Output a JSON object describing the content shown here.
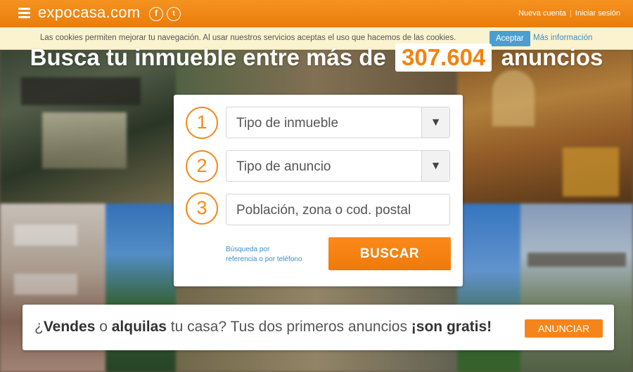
{
  "header": {
    "logo": "expocasa.com",
    "facebook_glyph": "f",
    "twitter_glyph": "t",
    "new_account": "Nueva cuenta",
    "separator": "|",
    "login": "Iniciar sesión"
  },
  "cookie_bar": {
    "message": "Las cookies permiten mejorar tu navegación. Al usar nuestros servicios aceptas el uso que hacemos de las cookies.",
    "accept": "Aceptar",
    "more_info": "Más información"
  },
  "headline": {
    "before": "Busca tu inmueble entre más de",
    "count": "307.604",
    "after": "anuncios"
  },
  "search": {
    "steps": [
      "1",
      "2",
      "3"
    ],
    "property_type": "Tipo de inmueble",
    "listing_type": "Tipo de anuncio",
    "location_placeholder": "Población, zona o cod. postal",
    "ref_link_line1": "Búsqueda por",
    "ref_link_line2": "referencia o por teléfono",
    "search_button": "BUSCAR",
    "dropdown_arrow": "▼"
  },
  "banner": {
    "q_open": "¿",
    "sell": "Vendes",
    "or": " o ",
    "rent": "alquilas",
    "middle": " tu casa? Tus dos primeros anuncios ",
    "free": "¡son gratis!",
    "button": "ANUNCIAR"
  },
  "colors": {
    "brand_orange": "#f08410",
    "link_blue": "#3a8fc8",
    "cookie_bg": "#fbf3cf"
  },
  "icons": [
    "menu-icon",
    "facebook-icon",
    "twitter-icon",
    "dropdown-arrow-icon"
  ]
}
